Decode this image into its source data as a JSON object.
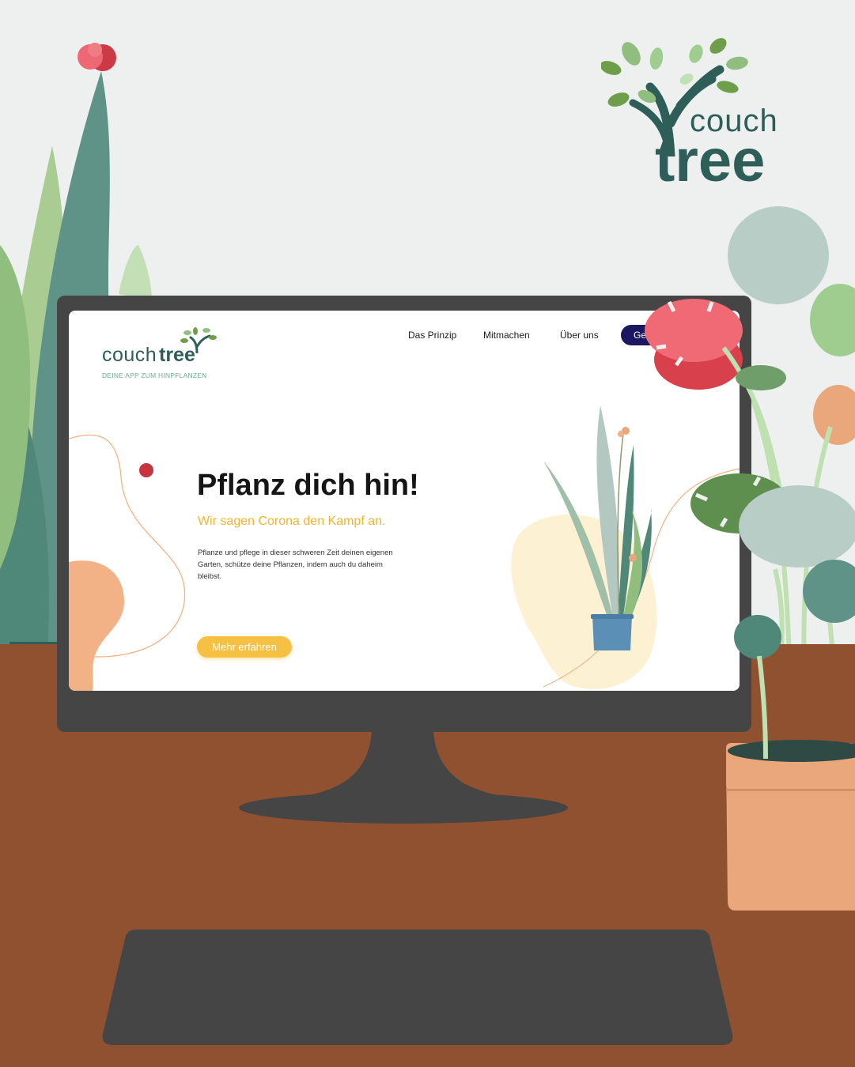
{
  "brand": {
    "name_top": "couch",
    "name_bottom": "tree"
  },
  "website": {
    "logo": {
      "couch": "couch",
      "tree": "tree",
      "tagline": "DEINE APP ZUM HINPFLANZEN"
    },
    "nav": [
      {
        "label": "Das Prinzip"
      },
      {
        "label": "Mitmachen"
      },
      {
        "label": "Über uns"
      }
    ],
    "cta_label": "Get",
    "hero": {
      "title": "Pflanz dich hin!",
      "subtitle": "Wir sagen Corona den Kampf an.",
      "body": "Pflanze und pflege in dieser schweren Zeit deinen eigenen Garten, schütze deine Pflanzen, indem auch du daheim bleibst.",
      "button_label": "Mehr erfahren"
    }
  },
  "colors": {
    "background": "#edf0ef",
    "desk": "#8f5130",
    "monitor": "#454545",
    "brand_green": "#2f5e58",
    "accent_yellow": "#f6c043",
    "cta_navy": "#1b1760",
    "tagline_green": "#6cab8f"
  }
}
